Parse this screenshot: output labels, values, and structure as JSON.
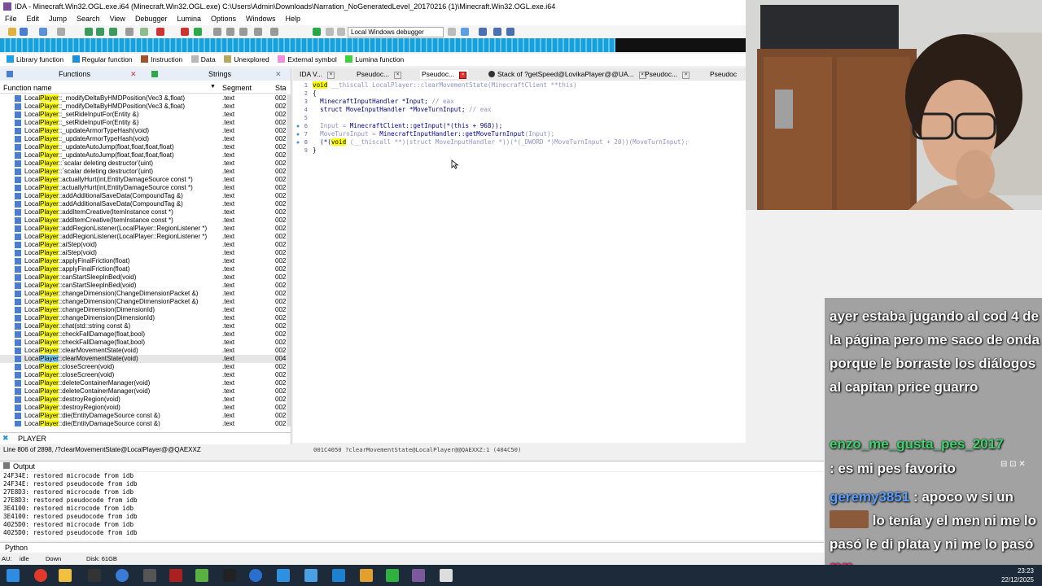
{
  "window": {
    "title": "IDA - Minecraft.Win32.OGL.exe.i64 (Minecraft.Win32.OGL.exe) C:\\Users\\Admin\\Downloads\\Narration_NoGeneratedLevel_20170216 (1)\\Minecraft.Win32.OGL.exe.i64"
  },
  "menu": [
    "File",
    "Edit",
    "Jump",
    "Search",
    "View",
    "Debugger",
    "Lumina",
    "Options",
    "Windows",
    "Help"
  ],
  "toolbar": {
    "debugger": "Local Windows debugger"
  },
  "legend": [
    {
      "label": "Library function",
      "color": "#1ea0e6"
    },
    {
      "label": "Regular function",
      "color": "#1e90d8"
    },
    {
      "label": "Instruction",
      "color": "#a0522d"
    },
    {
      "label": "Data",
      "color": "#b8b8b8"
    },
    {
      "label": "Unexplored",
      "color": "#b5a860"
    },
    {
      "label": "External symbol",
      "color": "#f08fe0"
    },
    {
      "label": "Lumina function",
      "color": "#40d040"
    }
  ],
  "functions_panel": {
    "title": "Functions",
    "strings_tab": "Strings",
    "col_name": "Function name",
    "col_segment": "Segment",
    "col_start": "Sta",
    "prefix": "Local",
    "hl": "Player",
    "rows": [
      {
        "suffix": "::_modifyDeltaByHMDPosition(Vec3 &,float)",
        "seg": ".text",
        "st": "002"
      },
      {
        "suffix": "::_modifyDeltaByHMDPosition(Vec3 &,float)",
        "seg": ".text",
        "st": "002"
      },
      {
        "suffix": "::_setRideInputFor(Entity &)",
        "seg": ".text",
        "st": "002"
      },
      {
        "suffix": "::_setRideInputFor(Entity &)",
        "seg": ".text",
        "st": "002"
      },
      {
        "suffix": "::_updateArmorTypeHash(void)",
        "seg": ".text",
        "st": "002"
      },
      {
        "suffix": "::_updateArmorTypeHash(void)",
        "seg": ".text",
        "st": "002"
      },
      {
        "suffix": "::_updateAutoJump(float,float,float,float)",
        "seg": ".text",
        "st": "002"
      },
      {
        "suffix": "::_updateAutoJump(float,float,float,float)",
        "seg": ".text",
        "st": "002"
      },
      {
        "suffix": "::`scalar deleting destructor'(uint)",
        "seg": ".text",
        "st": "002"
      },
      {
        "suffix": "::`scalar deleting destructor'(uint)",
        "seg": ".text",
        "st": "002"
      },
      {
        "suffix": "::actuallyHurt(int,EntityDamageSource const *)",
        "seg": ".text",
        "st": "002"
      },
      {
        "suffix": "::actuallyHurt(int,EntityDamageSource const *)",
        "seg": ".text",
        "st": "002"
      },
      {
        "suffix": "::addAdditionalSaveData(CompoundTag &)",
        "seg": ".text",
        "st": "002"
      },
      {
        "suffix": "::addAdditionalSaveData(CompoundTag &)",
        "seg": ".text",
        "st": "002"
      },
      {
        "suffix": "::addItemCreative(ItemInstance const *)",
        "seg": ".text",
        "st": "002"
      },
      {
        "suffix": "::addItemCreative(ItemInstance const *)",
        "seg": ".text",
        "st": "002"
      },
      {
        "suffix": "::addRegionListener(LocalPlayer::RegionListener *)",
        "seg": ".text",
        "st": "002"
      },
      {
        "suffix": "::addRegionListener(LocalPlayer::RegionListener *)",
        "seg": ".text",
        "st": "002"
      },
      {
        "suffix": "::aiStep(void)",
        "seg": ".text",
        "st": "002"
      },
      {
        "suffix": "::aiStep(void)",
        "seg": ".text",
        "st": "002"
      },
      {
        "suffix": "::applyFinalFriction(float)",
        "seg": ".text",
        "st": "002"
      },
      {
        "suffix": "::applyFinalFriction(float)",
        "seg": ".text",
        "st": "002"
      },
      {
        "suffix": "::canStartSleepInBed(void)",
        "seg": ".text",
        "st": "002"
      },
      {
        "suffix": "::canStartSleepInBed(void)",
        "seg": ".text",
        "st": "002"
      },
      {
        "suffix": "::changeDimension(ChangeDimensionPacket &)",
        "seg": ".text",
        "st": "002"
      },
      {
        "suffix": "::changeDimension(ChangeDimensionPacket &)",
        "seg": ".text",
        "st": "002"
      },
      {
        "suffix": "::changeDimension(DimensionId)",
        "seg": ".text",
        "st": "002"
      },
      {
        "suffix": "::changeDimension(DimensionId)",
        "seg": ".text",
        "st": "002"
      },
      {
        "suffix": "::chat(std::string const &)",
        "seg": ".text",
        "st": "002"
      },
      {
        "suffix": "::checkFallDamage(float,bool)",
        "seg": ".text",
        "st": "002"
      },
      {
        "suffix": "::checkFallDamage(float,bool)",
        "seg": ".text",
        "st": "002"
      },
      {
        "suffix": "::clearMovementState(void)",
        "seg": ".text",
        "st": "002"
      },
      {
        "suffix": "::clearMovementState(void)",
        "seg": ".text",
        "st": "004",
        "sel": true
      },
      {
        "suffix": "::closeScreen(void)",
        "seg": ".text",
        "st": "002"
      },
      {
        "suffix": "::closeScreen(void)",
        "seg": ".text",
        "st": "002"
      },
      {
        "suffix": "::deleteContainerManager(void)",
        "seg": ".text",
        "st": "002"
      },
      {
        "suffix": "::deleteContainerManager(void)",
        "seg": ".text",
        "st": "002"
      },
      {
        "suffix": "::destroyRegion(void)",
        "seg": ".text",
        "st": "002"
      },
      {
        "suffix": "::destroyRegion(void)",
        "seg": ".text",
        "st": "002"
      },
      {
        "suffix": "::die(EntityDamageSource const &)",
        "seg": ".text",
        "st": "002"
      },
      {
        "suffix": "::die(EntityDamageSource const &)",
        "seg": ".text",
        "st": "002"
      }
    ],
    "filter": "PLAYER",
    "status": "Line 806 of 2898, /?clearMovementState@LocalPlayer@@QAEXXZ"
  },
  "tabs": [
    "IDA V...",
    "Pseudoc...",
    "Pseudoc...",
    "Stack of ?getSpeed@LovikaPlayer@@UA...",
    "Pseudoc...",
    "Pseudoc"
  ],
  "code": {
    "l1_a": "void",
    "l1_b": " __thiscall LocalPlayer::clearMovementState(MinecraftClient **this)",
    "l2": "{",
    "l3_a": "  MinecraftInputHandler *Input; ",
    "l3_b": "// eax",
    "l4_a": "  struct MoveInputHandler *MoveTurnInput; ",
    "l4_b": "// eax",
    "l6_a": "  Input = ",
    "l6_b": "MinecraftClient::getInput",
    "l6_c": "(*(this + 968));",
    "l7_a": "  MoveTurnInput = ",
    "l7_b": "MinecraftInputHandler::getMoveTurnInput",
    "l7_c": "(Input);",
    "l8_a": "  (*(",
    "l8_b": "void",
    "l8_c": " (__thiscall **)(struct MoveInputHandler *))(*(_DWORD *)MoveTurnInput + 20))(MoveTurnInput);",
    "l9": "}",
    "line_numbers": [
      "1",
      "2",
      "3",
      "4",
      "5",
      "6",
      "7",
      "8",
      "9"
    ],
    "footer": "001C4050 ?clearMovementState@LocalPlayer@@QAEXXZ:1 (404C50)"
  },
  "output": {
    "title": "Output",
    "lines": [
      "24F34E: restored microcode from idb",
      "24F34E: restored pseudocode from idb",
      "27E8D3: restored microcode from idb",
      "27E8D3: restored pseudocode from idb",
      "3E4100: restored microcode from idb",
      "3E4100: restored pseudocode from idb",
      "4025D0: restored microcode from idb",
      "4025D0: restored pseudocode from idb"
    ],
    "lang": "Python",
    "status_au": "AU:",
    "status_idle": "idle",
    "status_down": "Down",
    "status_disk": "Disk: 61GB"
  },
  "chat": {
    "msg1": "ayer estaba jugando al cod 4 de la página pero me saco de onda porque le borraste los diálogos al capitan price guarro",
    "user2": "enzo_me_gusta_pes_2017",
    "msg2": ": es mi pes favorito",
    "user3": "geremy3851",
    "msg3a": ": apoco w si un",
    "msg3b": "lo tenía y el men ni me lo pasó le di plata y ni me lo pasó"
  },
  "clock": {
    "time": "23:23",
    "date": "22/12/2025"
  }
}
